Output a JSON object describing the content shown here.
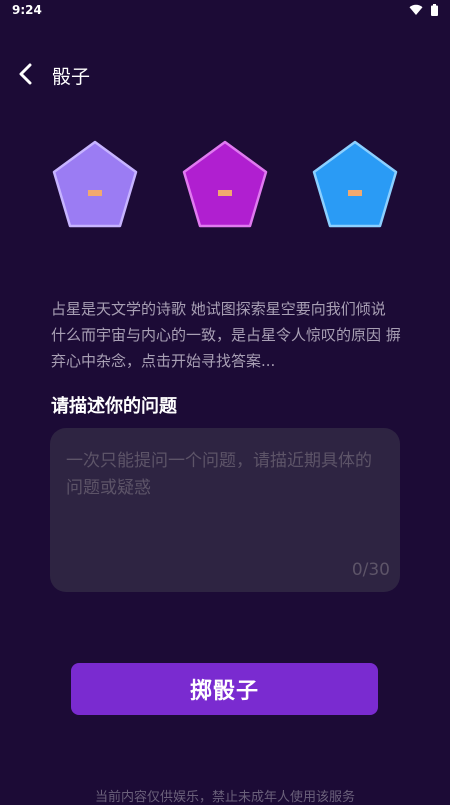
{
  "status_bar": {
    "time": "9:24",
    "icons": [
      "wifi-icon",
      "battery-icon"
    ]
  },
  "header": {
    "back_icon": "chevron-left-icon",
    "title": "骰子"
  },
  "dice": [
    {
      "name": "dice-purple",
      "color": "#9b7cf3",
      "border": "#c7b4ff"
    },
    {
      "name": "dice-magenta",
      "color": "#b01fd0",
      "border": "#e07af0"
    },
    {
      "name": "dice-blue",
      "color": "#2a9bf5",
      "border": "#8cd0ff"
    }
  ],
  "dice_mark_color": "#f2a96e",
  "description": "占星是天文学的诗歌 她试图探索星空要向我们倾说 什么而宇宙与内心的一致，是占星令人惊叹的原因 摒弃心中杂念，点击开始寻找答案...",
  "question": {
    "label": "请描述你的问题",
    "placeholder": "一次只能提问一个问题，请描近期具体的问题或疑惑",
    "value": "",
    "counter": "0/30"
  },
  "roll_button": "掷骰子",
  "disclaimer": "当前内容仅供娱乐，禁止未成年人使用该服务"
}
